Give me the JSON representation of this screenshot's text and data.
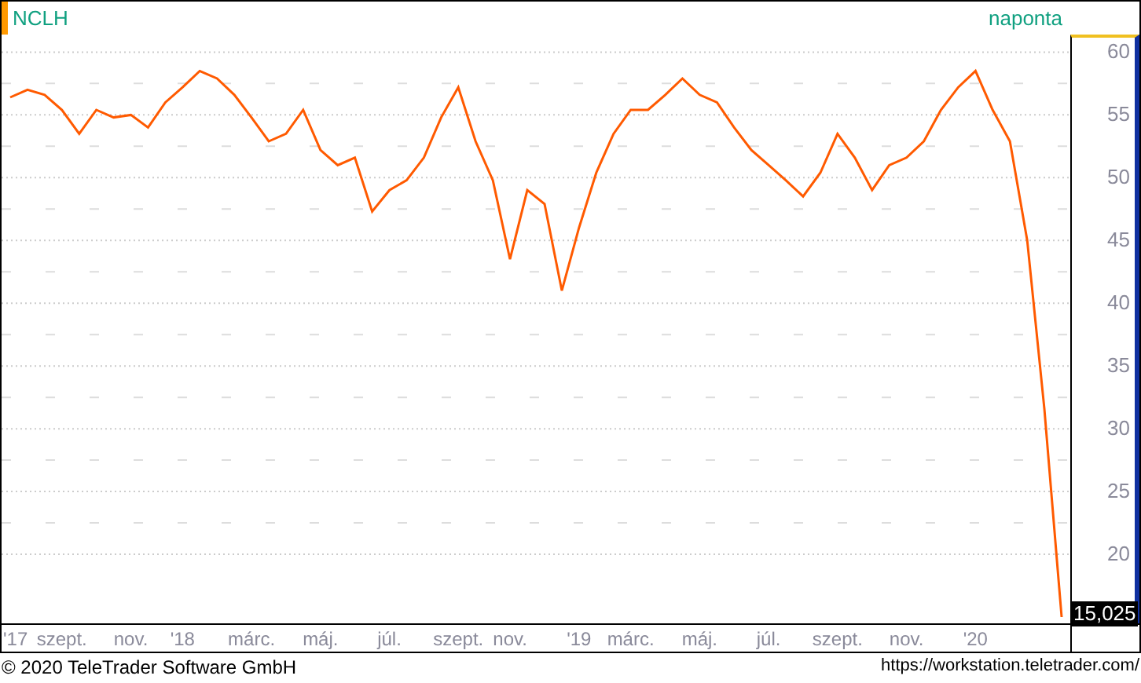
{
  "header": {
    "interval": "naponta"
  },
  "chart": {
    "chart_data": {
      "type": "line",
      "grid": true,
      "ylim": [
        14.5,
        61.4
      ],
      "yticks": [
        20,
        25,
        30,
        35,
        40,
        45,
        50,
        55,
        60
      ],
      "categories": [
        "'17",
        null,
        null,
        "szept.",
        null,
        null,
        null,
        "nov.",
        null,
        null,
        "'18",
        null,
        null,
        null,
        "márc.",
        null,
        null,
        null,
        "máj.",
        null,
        null,
        null,
        "júl.",
        null,
        null,
        null,
        "szept.",
        null,
        null,
        "nov.",
        null,
        null,
        null,
        "'19",
        null,
        null,
        "márc.",
        null,
        null,
        null,
        "máj.",
        null,
        null,
        null,
        "júl.",
        null,
        null,
        null,
        "szept.",
        null,
        null,
        null,
        "nov.",
        null,
        null,
        null,
        "'20",
        null,
        null,
        null,
        null,
        null
      ],
      "series": [
        {
          "name": "NCLH",
          "color": "#ff5a00",
          "values": [
            56.4,
            57,
            56.6,
            55.4,
            53.5,
            55.4,
            54.8,
            55,
            54,
            56,
            57.2,
            58.5,
            57.9,
            56.6,
            54.8,
            52.9,
            53.5,
            55.4,
            52.2,
            51,
            51.6,
            47.3,
            49,
            49.8,
            51.6,
            54.8,
            57.2,
            52.9,
            49.8,
            43.5,
            49,
            47.9,
            41,
            46,
            50.4,
            53.5,
            55.4,
            55.4,
            56.6,
            57.9,
            56.6,
            56,
            54,
            52.2,
            51,
            49.8,
            48.5,
            50.4,
            53.5,
            51.6,
            49,
            51,
            51.6,
            52.9,
            55.4,
            57.2,
            58.5,
            55.4,
            52.9,
            45,
            31.6,
            15
          ]
        }
      ]
    },
    "last_value": "15,025"
  },
  "footer": {
    "copyright": "© 2020 TeleTrader Software GmbH",
    "url": "https://workstation.teletrader.com/"
  }
}
